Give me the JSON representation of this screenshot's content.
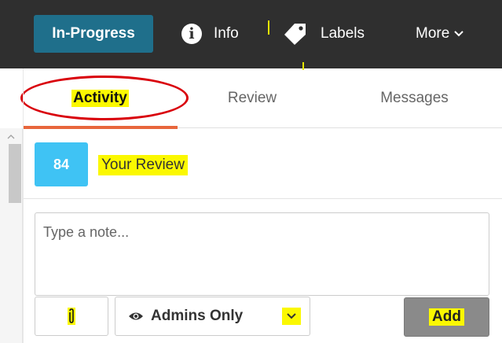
{
  "header": {
    "status_label": "In-Progress",
    "nav": {
      "info_label": "Info",
      "labels_label": "Labels",
      "more_label": "More"
    }
  },
  "tabs": [
    {
      "label": "Activity",
      "active": true
    },
    {
      "label": "Review",
      "active": false
    },
    {
      "label": "Messages",
      "active": false
    }
  ],
  "review": {
    "score": "84",
    "title": "Your Review"
  },
  "note": {
    "placeholder": "Type a note...",
    "value": ""
  },
  "composer": {
    "visibility_value": "Admins Only",
    "add_label": "Add"
  },
  "colors": {
    "status_bg": "#1f6f8b",
    "topbar_bg": "#2f2f2f",
    "score_bg": "#3fc3f4",
    "active_tab_underline": "#e8663c",
    "highlight": "#fbf800",
    "annotation_circle": "#d9000a",
    "add_button_bg": "#8a8a8a"
  },
  "icons": [
    "info-icon",
    "tag-icon",
    "chevron-down-icon",
    "paperclip-icon",
    "eye-icon",
    "scroll-up-arrow-icon"
  ]
}
